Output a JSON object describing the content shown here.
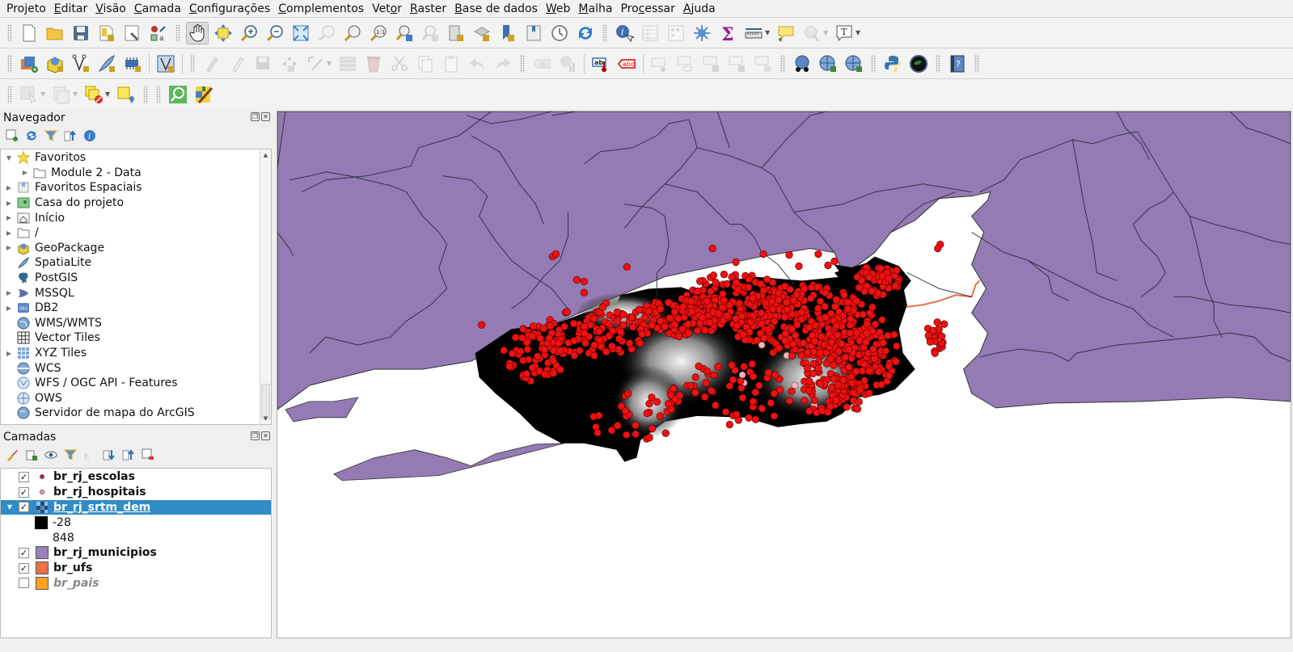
{
  "menubar": {
    "items": [
      {
        "label": "Projeto",
        "mnemonic": "j"
      },
      {
        "label": "Editar",
        "mnemonic": "E"
      },
      {
        "label": "Visão",
        "mnemonic": "V"
      },
      {
        "label": "Camada",
        "mnemonic": "C"
      },
      {
        "label": "Configurações",
        "mnemonic": "C"
      },
      {
        "label": "Complementos",
        "mnemonic": "C"
      },
      {
        "label": "Vetor",
        "mnemonic": "o"
      },
      {
        "label": "Raster",
        "mnemonic": "R"
      },
      {
        "label": "Base de dados",
        "mnemonic": "B"
      },
      {
        "label": "Web",
        "mnemonic": "W"
      },
      {
        "label": "Malha",
        "mnemonic": "M"
      },
      {
        "label": "Processar",
        "mnemonic": "c"
      },
      {
        "label": "Ajuda",
        "mnemonic": "A"
      }
    ]
  },
  "toolbars": {
    "project": [
      "new-project-icon",
      "open-project-icon",
      "save-project-icon",
      "new-print-layout-icon",
      "style-manager-icon",
      "label-style-icon"
    ],
    "navigation": [
      "pan-icon",
      "pan-to-selection-icon",
      "zoom-in-icon",
      "zoom-out-icon",
      "zoom-full-icon",
      "zoom-to-selection-icon",
      "zoom-to-layer-icon",
      "zoom-native-icon",
      "zoom-last-icon",
      "zoom-next-icon",
      "new-map-view-icon",
      "new-3d-view-icon",
      "new-bookmark-icon",
      "show-bookmarks-icon",
      "temporal-controller-icon",
      "refresh-icon"
    ],
    "attributes": [
      "identify-icon",
      "attribute-table-icon",
      "field-calculator-icon",
      "statistics-icon",
      "sum-icon",
      "measure-icon",
      "annotation-icon",
      "map-tips-icon",
      "text-annotation-icon"
    ],
    "layers": [
      "data-source-manager-icon",
      "new-geopackage-icon",
      "new-shapefile-icon",
      "new-spatialite-icon",
      "new-temporary-layer-icon",
      "new-virtual-layer-icon"
    ],
    "digitizing": [
      "current-edits-icon",
      "toggle-editing-icon",
      "save-edits-icon",
      "add-feature-icon",
      "vertex-tool-icon",
      "modify-attributes-icon",
      "delete-selected-icon",
      "cut-features-icon",
      "copy-features-icon",
      "paste-features-icon",
      "undo-icon",
      "redo-icon"
    ],
    "labels": [
      "label-toolbar-icon",
      "diagram-icon",
      "layer-labeling-icon",
      "layer-labeling-rules-icon",
      "pin-labels-icon",
      "show-hide-labels-icon",
      "move-label-icon",
      "rotate-label-icon",
      "change-label-icon"
    ],
    "web": [
      "metasearch-icon",
      "add-wms-icon",
      "search-wms-icon"
    ],
    "plugins": [
      "python-console-icon",
      "globe-icon",
      "help-icon"
    ],
    "selection": [
      "select-features-icon",
      "select-by-attributes-icon",
      "deselect-icon",
      "select-by-location-icon"
    ],
    "extra": [
      "locator-search-icon",
      "georeferencer-icon"
    ]
  },
  "navigator": {
    "title": "Navegador",
    "items": [
      {
        "label": "Favoritos",
        "icon": "star-icon",
        "expander": "expanded",
        "indent": 0
      },
      {
        "label": "Module 2 - Data",
        "icon": "folder-icon",
        "expander": "collapsed",
        "indent": 1
      },
      {
        "label": "Favoritos Espaciais",
        "icon": "spatial-bookmark-icon",
        "expander": "collapsed",
        "indent": 0
      },
      {
        "label": "Casa do projeto",
        "icon": "project-home-icon",
        "expander": "collapsed",
        "indent": 0
      },
      {
        "label": "Início",
        "icon": "home-folder-icon",
        "expander": "collapsed",
        "indent": 0
      },
      {
        "label": "/",
        "icon": "folder-icon",
        "expander": "collapsed",
        "indent": 0
      },
      {
        "label": "GeoPackage",
        "icon": "geopackage-icon",
        "expander": "collapsed",
        "indent": 0
      },
      {
        "label": "SpatiaLite",
        "icon": "spatialite-icon",
        "expander": "none",
        "indent": 0
      },
      {
        "label": "PostGIS",
        "icon": "postgis-icon",
        "expander": "none",
        "indent": 0
      },
      {
        "label": "MSSQL",
        "icon": "mssql-icon",
        "expander": "collapsed",
        "indent": 0
      },
      {
        "label": "DB2",
        "icon": "db2-icon",
        "expander": "collapsed",
        "indent": 0
      },
      {
        "label": "WMS/WMTS",
        "icon": "wms-icon",
        "expander": "none",
        "indent": 0
      },
      {
        "label": "Vector Tiles",
        "icon": "vector-tiles-icon",
        "expander": "none",
        "indent": 0
      },
      {
        "label": "XYZ Tiles",
        "icon": "xyz-tiles-icon",
        "expander": "collapsed",
        "indent": 0
      },
      {
        "label": "WCS",
        "icon": "wcs-icon",
        "expander": "none",
        "indent": 0
      },
      {
        "label": "WFS / OGC API - Features",
        "icon": "wfs-icon",
        "expander": "none",
        "indent": 0
      },
      {
        "label": "OWS",
        "icon": "ows-icon",
        "expander": "none",
        "indent": 0
      },
      {
        "label": "Servidor de mapa do ArcGIS",
        "icon": "arcgis-icon",
        "expander": "none",
        "indent": 0
      }
    ]
  },
  "layers_panel": {
    "title": "Camadas",
    "layers": [
      {
        "name": "br_rj_escolas",
        "checked": true,
        "symbol": "dot",
        "color": "#e31a1c",
        "selected": false
      },
      {
        "name": "br_rj_hospitais",
        "checked": true,
        "symbol": "dot",
        "color": "#f4a6b4",
        "selected": false
      },
      {
        "name": "br_rj_srtm_dem",
        "checked": true,
        "symbol": "raster",
        "color": "#1f4e79",
        "selected": true,
        "expanded": true,
        "legend": [
          {
            "label": "-28",
            "color": "#000000"
          },
          {
            "label": "848",
            "color": "#ffffff"
          }
        ]
      },
      {
        "name": "br_rj_municipios",
        "checked": true,
        "symbol": "fill",
        "color": "#9a7fba",
        "selected": false
      },
      {
        "name": "br_ufs",
        "checked": true,
        "symbol": "fill",
        "color": "#e8704a",
        "selected": false
      },
      {
        "name": "br_pais",
        "checked": false,
        "symbol": "fill",
        "color": "#ffa21f",
        "selected": false,
        "disabled": true
      }
    ]
  },
  "map": {
    "colors": {
      "municipios": "#947bb4",
      "water": "#ffffff",
      "dem_low": "#000000",
      "dem_high": "#ffffff",
      "escolas": "#ee1111",
      "hospitais": "#f4b4c0",
      "ufs_edge": "#e8704a"
    }
  }
}
